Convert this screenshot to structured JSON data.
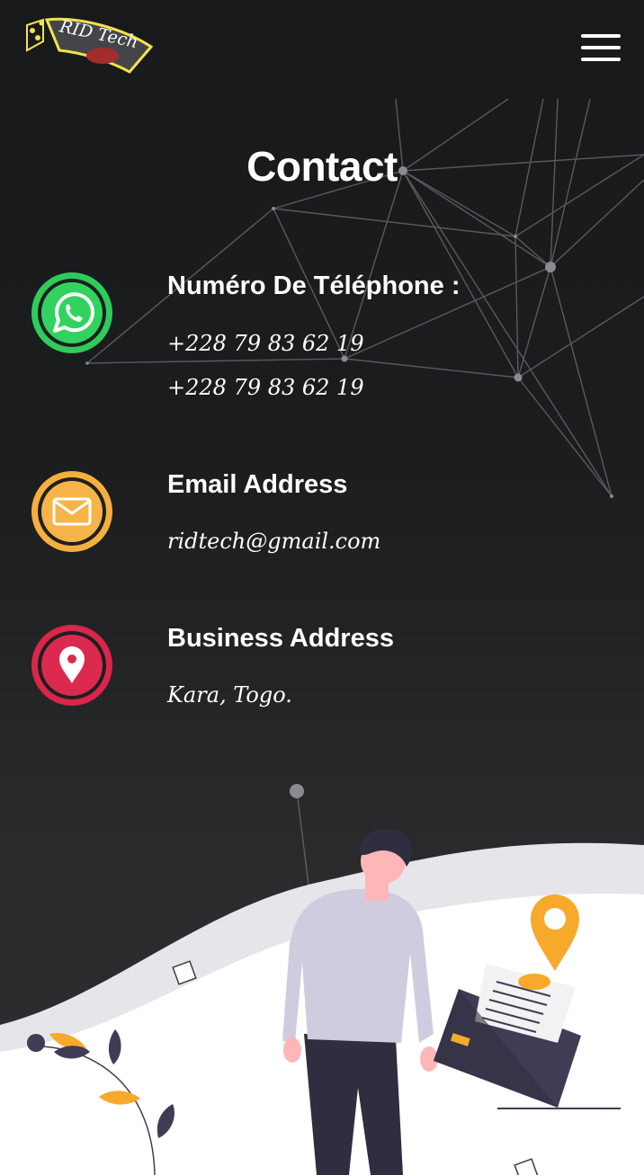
{
  "header": {
    "logo_text": "RID Tech",
    "menu_icon": "hamburger-menu-icon"
  },
  "main": {
    "title": "Contact",
    "phone": {
      "icon": "whatsapp-icon",
      "heading": "Numéro De Téléphone :",
      "numbers": [
        "+228 79 83 62 19",
        "+228 79 83 62 19"
      ]
    },
    "email": {
      "icon": "envelope-icon",
      "heading": "Email Address",
      "value": "ridtech@gmail.com"
    },
    "address": {
      "icon": "location-pin-icon",
      "heading": "Business Address",
      "value": "Kara, Togo."
    }
  },
  "colors": {
    "background": "#1c1d1f",
    "whatsapp": "#2ecc5c",
    "email": "#f4b03e",
    "location": "#d9264a",
    "accent": "#f7a92b"
  }
}
